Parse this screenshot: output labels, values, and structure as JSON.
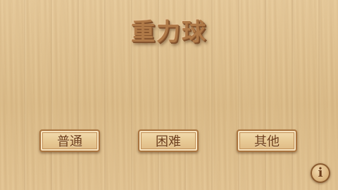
{
  "title": "重力球",
  "menu": {
    "normal_label": "普通",
    "hard_label": "困难",
    "other_label": "其他"
  },
  "info_button": {
    "glyph": "i",
    "icon": "info-icon"
  },
  "colors": {
    "wood_background": "#e2c595",
    "button_border": "#a9743f",
    "button_text": "#6b3c1a",
    "title_text": "#b07a48"
  }
}
